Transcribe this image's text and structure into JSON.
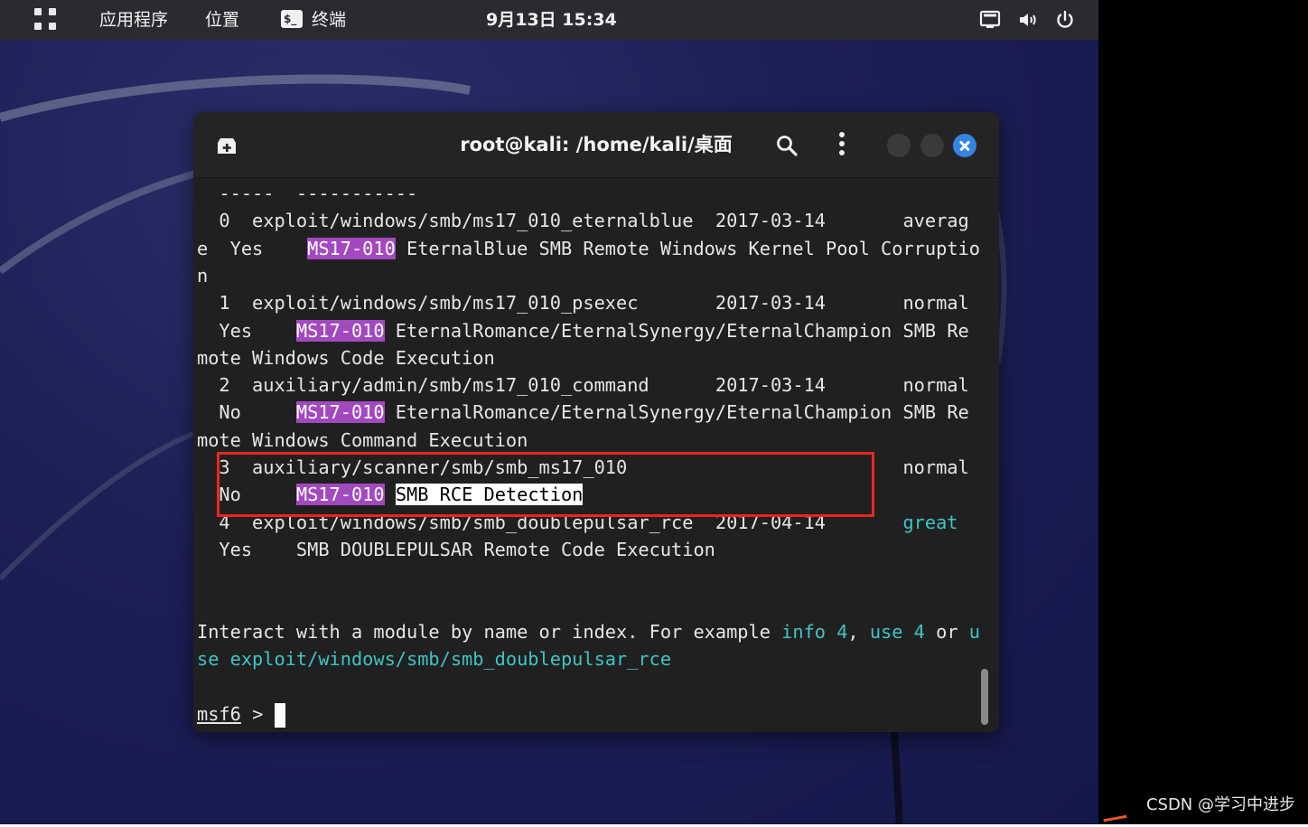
{
  "topbar": {
    "apps_label": "应用程序",
    "places_label": "位置",
    "terminal_label": "终端",
    "terminal_icon_text": "$_",
    "clock": "9月13日 15:34"
  },
  "terminal": {
    "title": "root@kali: /home/kali/桌面",
    "prompt": "msf6",
    "prompt_symbol": ">",
    "lines": [
      [
        {
          "t": "  -----  -----------"
        }
      ],
      [
        {
          "t": "  0  exploit/windows/smb/ms17_010_eternalblue  2017-03-14       averag"
        }
      ],
      [
        {
          "t": "e  Yes    "
        },
        {
          "t": "MS17-010",
          "c": "hl"
        },
        {
          "t": " EternalBlue SMB Remote Windows Kernel Pool Corruptio"
        }
      ],
      [
        {
          "t": "n"
        }
      ],
      [
        {
          "t": "  1  exploit/windows/smb/ms17_010_psexec       2017-03-14       normal"
        }
      ],
      [
        {
          "t": "  Yes    "
        },
        {
          "t": "MS17-010",
          "c": "hl"
        },
        {
          "t": " EternalRomance/EternalSynergy/EternalChampion SMB Re"
        }
      ],
      [
        {
          "t": "mote Windows Code Execution"
        }
      ],
      [
        {
          "t": "  2  auxiliary/admin/smb/ms17_010_command      2017-03-14       normal"
        }
      ],
      [
        {
          "t": "  No     "
        },
        {
          "t": "MS17-010",
          "c": "hl"
        },
        {
          "t": " EternalRomance/EternalSynergy/EternalChampion SMB Re"
        }
      ],
      [
        {
          "t": "mote Windows Command Execution"
        }
      ],
      [
        {
          "t": "  3  auxiliary/scanner/smb/smb_ms17_010                         normal"
        }
      ],
      [
        {
          "t": "  No     "
        },
        {
          "t": "MS17-010",
          "c": "hl"
        },
        {
          "t": " "
        },
        {
          "t": "SMB RCE Detection",
          "c": "hl-white"
        }
      ],
      [
        {
          "t": "  4  exploit/windows/smb/smb_doublepulsar_rce  2017-04-14       "
        },
        {
          "t": "great",
          "c": "cyan"
        }
      ],
      [
        {
          "t": "  Yes    SMB DOUBLEPULSAR Remote Code Execution"
        }
      ],
      [
        {
          "t": ""
        }
      ],
      [
        {
          "t": ""
        }
      ],
      [
        {
          "t": "Interact with a module by name or index. For example "
        },
        {
          "t": "info 4",
          "c": "cyan"
        },
        {
          "t": ", "
        },
        {
          "t": "use 4",
          "c": "cyan"
        },
        {
          "t": " or "
        },
        {
          "t": "u",
          "c": "cyan"
        }
      ],
      [
        {
          "t": "se exploit/windows/smb/smb_doublepulsar_rce",
          "c": "cyan"
        }
      ],
      [
        {
          "t": ""
        }
      ]
    ]
  },
  "watermark": "CSDN @学习中进步",
  "colors": {
    "highlight": "#a349c0",
    "cyan": "#3fc4c4",
    "close_button": "#3584e4",
    "red_box": "#e8271f"
  },
  "icons": [
    "apps-grid-icon",
    "terminal-icon",
    "new-tab-icon",
    "search-icon",
    "menu-icon",
    "screen-icon",
    "volume-icon",
    "power-icon",
    "close-icon"
  ]
}
